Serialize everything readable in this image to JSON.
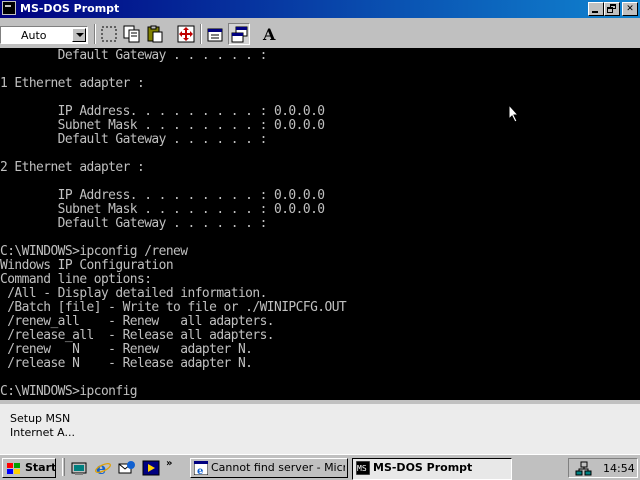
{
  "window": {
    "title": "MS-DOS Prompt",
    "font_select_value": "Auto"
  },
  "toolbar_icons": [
    "mark-icon",
    "copy-icon",
    "paste-icon",
    "full-screen-icon",
    "properties-icon",
    "background-icon",
    "font-icon"
  ],
  "console_lines": [
    "        Default Gateway . . . . . . :",
    "",
    "1 Ethernet adapter :",
    "",
    "        IP Address. . . . . . . . . : 0.0.0.0",
    "        Subnet Mask . . . . . . . . : 0.0.0.0",
    "        Default Gateway . . . . . . :",
    "",
    "2 Ethernet adapter :",
    "",
    "        IP Address. . . . . . . . . : 0.0.0.0",
    "        Subnet Mask . . . . . . . . : 0.0.0.0",
    "        Default Gateway . . . . . . :",
    "",
    "C:\\WINDOWS>ipconfig /renew",
    "Windows IP Configuration",
    "Command line options:",
    " /All - Display detailed information.",
    " /Batch [file] - Write to file or ./WINIPCFG.OUT",
    " /renew_all    - Renew   all adapters.",
    " /release_all  - Release all adapters.",
    " /renew   N    - Renew   adapter N.",
    " /release N    - Release adapter N.",
    "",
    "C:\\WINDOWS>ipconfig"
  ],
  "desktop": {
    "msn_icon_label_line1": "Setup MSN",
    "msn_icon_label_line2": "Internet A..."
  },
  "taskbar": {
    "start_label": "Start",
    "tasks": [
      {
        "label": "Cannot find server - Micros...",
        "active": false
      },
      {
        "label": "MS-DOS Prompt",
        "active": true
      }
    ],
    "quick_launch_more": "»",
    "clock": "14:54"
  },
  "colors": {
    "title_bar": "#000080",
    "console_bg": "#000000",
    "console_text": "#c0c0c0",
    "chrome": "#c0c0c0"
  }
}
